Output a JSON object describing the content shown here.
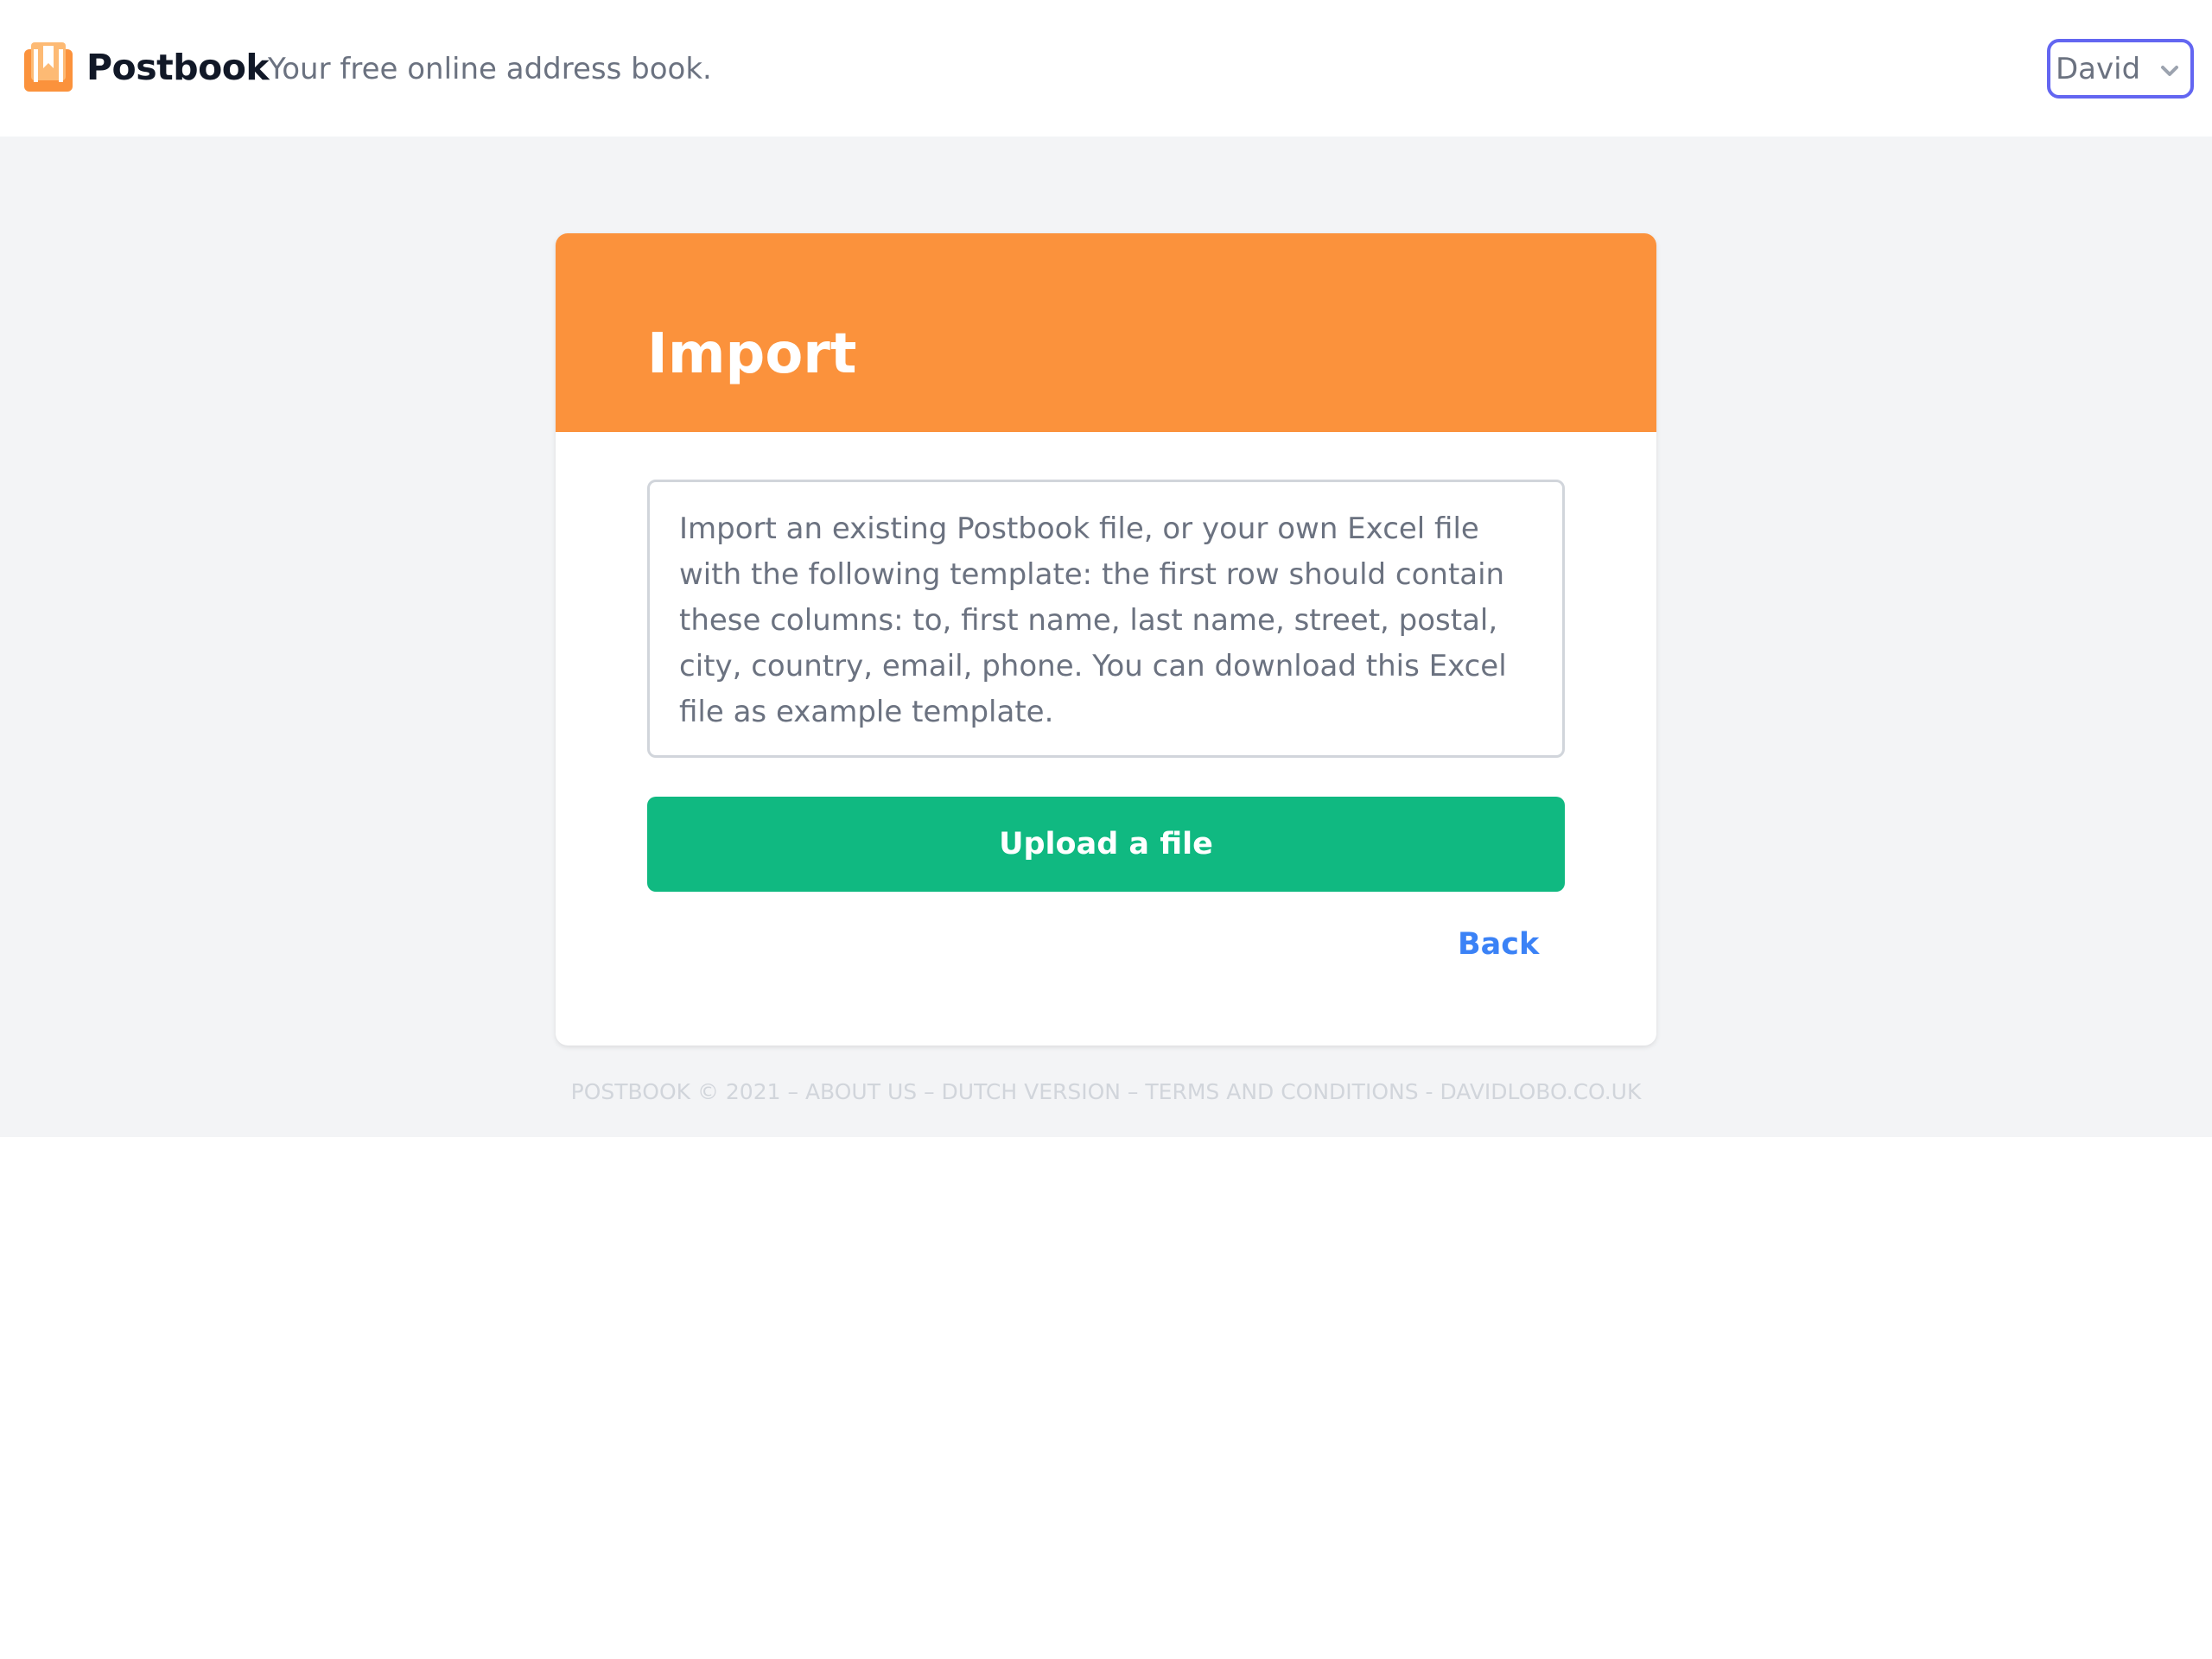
{
  "header": {
    "brand": "Postbook",
    "tagline": "Your free online address book.",
    "user_select": {
      "selected": "David"
    }
  },
  "card": {
    "title": "Import",
    "info_text": "Import an existing Postbook file, or your own Excel file with the following template: the first row should contain these columns: to, first name, last name, street, postal, city, country, email, phone. You can download this Excel file as example template.",
    "upload_label": "Upload a file",
    "back_label": "Back"
  },
  "footer": {
    "copyright": "POSTBOOK © 2021",
    "sep1": " – ",
    "about": "ABOUT US",
    "sep2": " – ",
    "dutch": "DUTCH VERSION",
    "sep3": " – ",
    "terms": "TERMS AND CONDITIONS",
    "sep4": " - ",
    "site": "DAVIDLOBO.CO.UK"
  },
  "colors": {
    "accent_orange": "#fb923c",
    "upload_green": "#10b981",
    "link_blue": "#3b82f6",
    "focus_ring": "#6366f1"
  },
  "icons": {
    "logo": "bookmark-book-icon",
    "user_select_caret": "chevron-down-icon"
  }
}
